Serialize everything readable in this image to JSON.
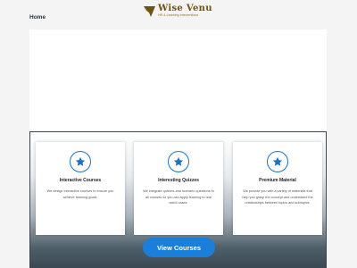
{
  "nav": {
    "home_label": "Home"
  },
  "logo": {
    "title": "Wise Venu",
    "tagline": "HR & Learning Interventions",
    "brand_color": "#6b5410"
  },
  "features": {
    "accent_color": "#1e73be",
    "cards": [
      {
        "icon": "star-icon",
        "title": "Interactive Courses",
        "text": "We design interactive courses to ensure you achieve learning goals."
      },
      {
        "icon": "star-icon",
        "title": "Interesting Quizzes",
        "text": "We integrate quizzes and scenario questions to all courses so you can apply learning to real world cases."
      },
      {
        "icon": "star-icon",
        "title": "Premium Material",
        "text": "We provide you with a variety of materials that help you grasp the concept and understand the relationships between topics and subtopics."
      }
    ]
  },
  "cta": {
    "label": "View Courses",
    "color": "#1b7fd9"
  }
}
